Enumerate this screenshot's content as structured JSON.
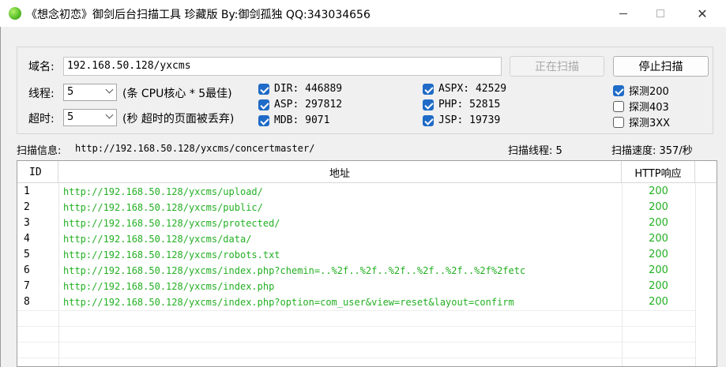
{
  "window": {
    "title": "《想念初恋》御剑后台扫描工具 珍藏版 By:御剑孤独 QQ:343034656",
    "minimize": "—",
    "maximize": "☐",
    "close": "✕"
  },
  "form": {
    "domain_label": "域名:",
    "domain_value": "192.168.50.128/yxcms",
    "scanning_button": "正在扫描",
    "stop_button": "停止扫描",
    "threads_label": "线程:",
    "threads_value": "5",
    "threads_hint": "(条 CPU核心 * 5最佳)",
    "timeout_label": "超时:",
    "timeout_value": "5",
    "timeout_hint": "(秒 超时的页面被丢弃)"
  },
  "dictionaries": [
    {
      "label": "DIR: 446889",
      "checked": true
    },
    {
      "label": "ASP: 297812",
      "checked": true
    },
    {
      "label": "MDB: 9071",
      "checked": true
    },
    {
      "label": "ASPX: 42529",
      "checked": true
    },
    {
      "label": "PHP: 52815",
      "checked": true
    },
    {
      "label": "JSP: 19739",
      "checked": true
    }
  ],
  "status_filters": [
    {
      "label": "探测200",
      "checked": true
    },
    {
      "label": "探测403",
      "checked": false
    },
    {
      "label": "探测3XX",
      "checked": false
    }
  ],
  "status_bar": {
    "info_label": "扫描信息:",
    "info_value": "http://192.168.50.128/yxcms/concertmaster/",
    "threads_text": "扫描线程: 5",
    "speed_text": "扫描速度: 357/秒"
  },
  "table": {
    "columns": [
      "ID",
      "地址",
      "HTTP响应"
    ],
    "rows": [
      {
        "id": "1",
        "url": "http://192.168.50.128/yxcms/upload/",
        "code": "200"
      },
      {
        "id": "2",
        "url": "http://192.168.50.128/yxcms/public/",
        "code": "200"
      },
      {
        "id": "3",
        "url": "http://192.168.50.128/yxcms/protected/",
        "code": "200"
      },
      {
        "id": "4",
        "url": "http://192.168.50.128/yxcms/data/",
        "code": "200"
      },
      {
        "id": "5",
        "url": "http://192.168.50.128/yxcms/robots.txt",
        "code": "200"
      },
      {
        "id": "6",
        "url": "http://192.168.50.128/yxcms/index.php?chemin=..%2f..%2f..%2f..%2f..%2f..%2f%2fetc",
        "code": "200"
      },
      {
        "id": "7",
        "url": "http://192.168.50.128/yxcms/index.php",
        "code": "200"
      },
      {
        "id": "8",
        "url": "http://192.168.50.128/yxcms/index.php?option=com_user&view=reset&layout=confirm",
        "code": "200"
      }
    ]
  },
  "colors": {
    "accent": "#1f6bc7",
    "result_green": "#22b022"
  }
}
